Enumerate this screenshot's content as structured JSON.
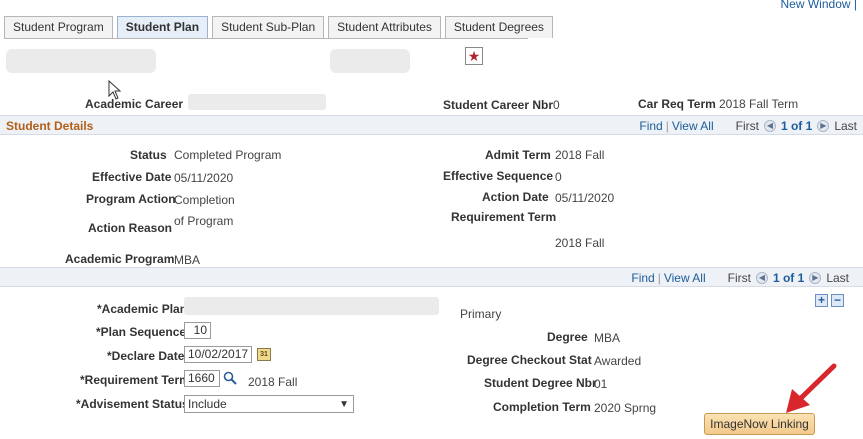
{
  "header": {
    "new_window_link": "New Window |"
  },
  "tabs": [
    {
      "label": "Student Program",
      "active": false
    },
    {
      "label": "Student Plan",
      "active": true
    },
    {
      "label": "Student Sub-Plan",
      "active": false
    },
    {
      "label": "Student Attributes",
      "active": false
    },
    {
      "label": "Student Degrees",
      "active": false
    }
  ],
  "icons": {
    "star": "star-icon",
    "cursor": "mouse-pointer-icon",
    "lookup": "magnifier-icon",
    "calendar": "calendar-icon",
    "arrow": "red-arrow-icon"
  },
  "colors": {
    "section_title": "#b25f18",
    "link": "#1d5c9a",
    "button": "#f3c98a",
    "arrow": "#d9262c"
  },
  "career": {
    "academic_career_label": "Academic Career",
    "career_nbr_label": "Student Career Nbr",
    "career_nbr_value": "0",
    "car_req_term_label": "Car Req Term",
    "car_req_term_value": "2018 Fall Term"
  },
  "student_details": {
    "title": "Student Details",
    "find": "Find",
    "view_all": "View All",
    "first": "First",
    "count": "1 of 1",
    "last": "Last",
    "status_label": "Status",
    "status_value": "Completed Program",
    "effective_date_label": "Effective Date",
    "effective_date_value": "05/11/2020",
    "program_action_label": "Program Action",
    "program_action_value": "Completion",
    "action_reason_label": "Action Reason",
    "action_reason_value": "of Program",
    "academic_program_label": "Academic Program",
    "academic_program_value": "MBA",
    "admit_term_label": "Admit Term",
    "admit_term_value": "2018 Fall",
    "effective_sequence_label": "Effective Sequence",
    "effective_sequence_value": "0",
    "action_date_label": "Action Date",
    "action_date_value": "05/11/2020",
    "requirement_term_label": "Requirement Term",
    "requirement_term_value": "2018 Fall"
  },
  "plan": {
    "find": "Find",
    "view_all": "View All",
    "first": "First",
    "count": "1 of 1",
    "last": "Last",
    "academic_plan_label": "*Academic Plan",
    "plan_sequence_label": "*Plan Sequence",
    "plan_sequence_value": "10",
    "declare_date_label": "*Declare Date",
    "declare_date_value": "10/02/2017",
    "requirement_term_label": "*Requirement Term",
    "requirement_term_value": "1660",
    "requirement_term_desc": "2018 Fall",
    "advisement_status_label": "*Advisement Status",
    "advisement_status_value": "Include",
    "primary": "Primary",
    "degree_label": "Degree",
    "degree_value": "MBA",
    "degree_checkout_label": "Degree Checkout Stat",
    "degree_checkout_value": "Awarded",
    "student_degree_nbr_label": "Student Degree Nbr",
    "student_degree_nbr_value": "01",
    "completion_term_label": "Completion Term",
    "completion_term_value": "2020 Sprng",
    "add_row": "+",
    "delete_row": "−"
  },
  "imagenow_button": "ImageNow Linking"
}
